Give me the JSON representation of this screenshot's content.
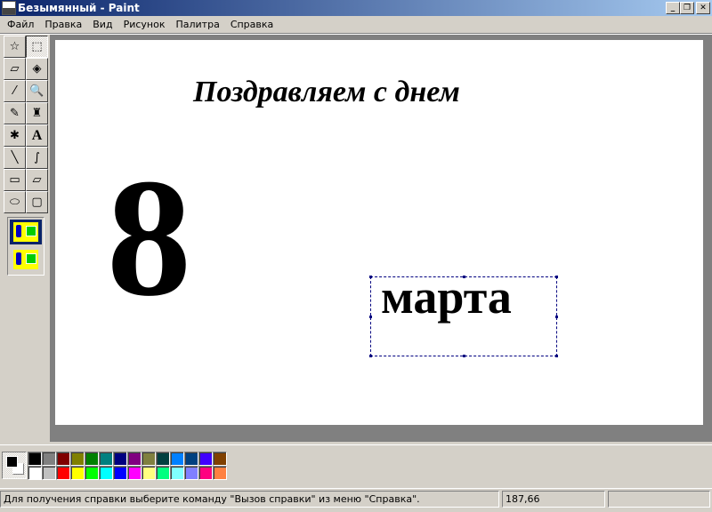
{
  "window": {
    "title": "Безымянный - Paint",
    "controls": [
      "minimize",
      "restore",
      "close"
    ]
  },
  "menu": [
    "Файл",
    "Правка",
    "Вид",
    "Рисунок",
    "Палитра",
    "Справка"
  ],
  "tools": [
    {
      "name": "free-select",
      "glyph": "☆"
    },
    {
      "name": "rect-select",
      "glyph": "⬚"
    },
    {
      "name": "eraser",
      "glyph": "▱"
    },
    {
      "name": "fill",
      "glyph": "◈"
    },
    {
      "name": "color-picker",
      "glyph": "⁄"
    },
    {
      "name": "magnifier",
      "glyph": "🔍"
    },
    {
      "name": "pencil",
      "glyph": "✎"
    },
    {
      "name": "brush",
      "glyph": "♜"
    },
    {
      "name": "airbrush",
      "glyph": "✱"
    },
    {
      "name": "text",
      "glyph": "A"
    },
    {
      "name": "line",
      "glyph": "╲"
    },
    {
      "name": "curve",
      "glyph": "∫"
    },
    {
      "name": "rectangle",
      "glyph": "▭"
    },
    {
      "name": "polygon",
      "glyph": "▱"
    },
    {
      "name": "ellipse",
      "glyph": "⬭"
    },
    {
      "name": "rounded-rectangle",
      "glyph": "▢"
    }
  ],
  "canvas": {
    "greeting": "Поздравляем с днем",
    "number": "8",
    "month": "марта"
  },
  "colors": {
    "foreground": "#000000",
    "background": "#ffffff"
  },
  "palette": [
    "#000000",
    "#808080",
    "#800000",
    "#808000",
    "#008000",
    "#008080",
    "#000080",
    "#800080",
    "#808040",
    "#004040",
    "#0080ff",
    "#004080",
    "#4000ff",
    "#804000",
    "#ffffff",
    "#c0c0c0",
    "#ff0000",
    "#ffff00",
    "#00ff00",
    "#00ffff",
    "#0000ff",
    "#ff00ff",
    "#ffff80",
    "#00ff80",
    "#80ffff",
    "#8080ff",
    "#ff0080",
    "#ff8040"
  ],
  "status": {
    "help": "Для получения справки выберите команду \"Вызов справки\" из меню \"Справка\".",
    "coords": "187,66",
    "size": ""
  }
}
